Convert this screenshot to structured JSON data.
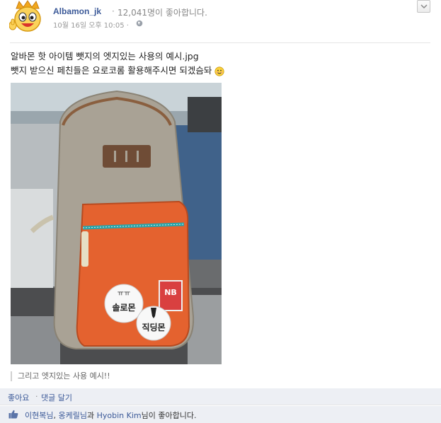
{
  "post": {
    "page_name": "Albamon_jk",
    "separator": "·",
    "page_likes": "12,041명이 좋아합니다.",
    "timestamp": "10월 16일 오후 10:05 ·",
    "message_line1": "알바몬 핫 아이템 뺏지의 엣지있는 사용의 예시.jpg",
    "message_line2": "뺏지 받으신 페친들은 요로코롬 활용해주시면 되겠슴돠",
    "photo_badge_left_text": "솔로몬",
    "photo_badge_left_small": "ㅠㅠ",
    "photo_badge_right_text": "직딩몬",
    "caption": "그리고 엣지있는 사용 예시!!"
  },
  "actions": {
    "like_label": "좋아요",
    "dot": "·",
    "comment_label": "댓글 달기"
  },
  "likes": {
    "user1": "이현복님",
    "sep1": ", ",
    "user2": "옹케릴님",
    "sep2": "과 ",
    "user3": "Hyobin Kim",
    "suffix": "님이 좋아합니다."
  },
  "colors": {
    "link_blue": "#3b5998",
    "bar_bg": "#edeff4",
    "bag_orange": "#e4622f"
  }
}
